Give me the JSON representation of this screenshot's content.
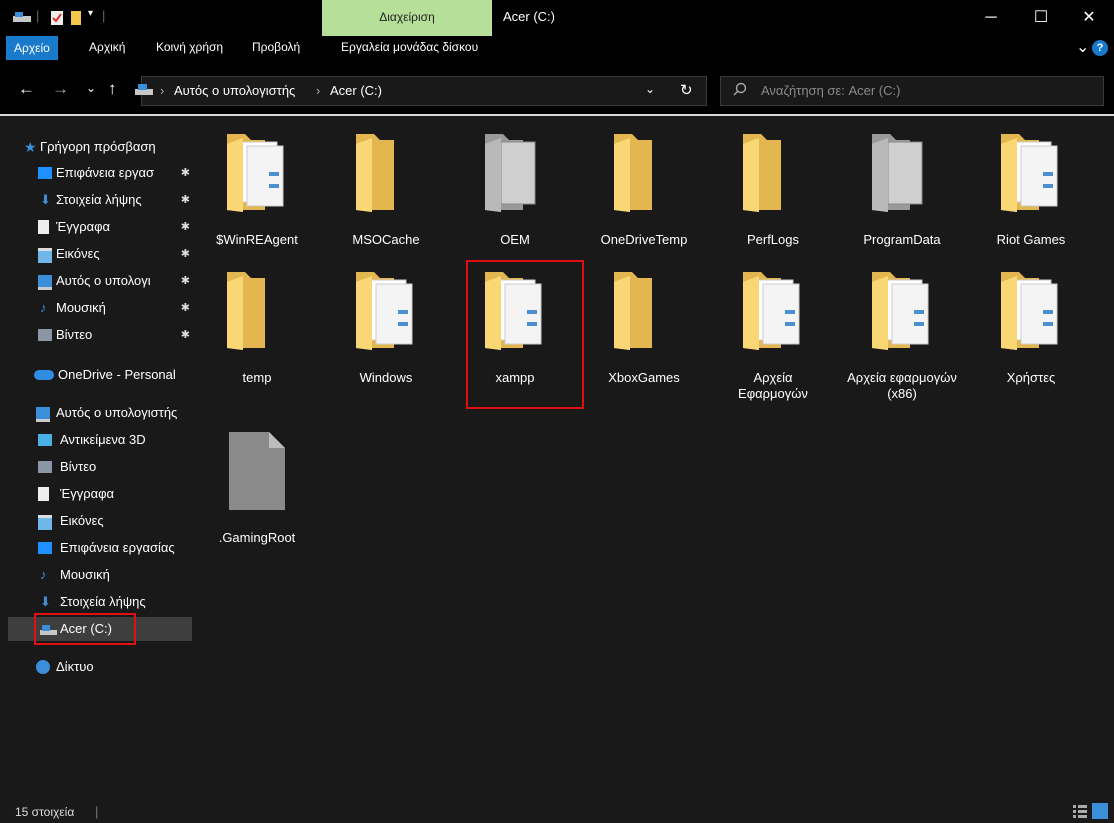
{
  "window": {
    "title": "Acer (C:)",
    "manage_tab": "Διαχείριση",
    "minimize": "─",
    "maximize": "☐",
    "close": "✕"
  },
  "ribbon": {
    "tabs": [
      "Αρχείο",
      "Αρχική",
      "Κοινή χρήση",
      "Προβολή",
      "Εργαλεία μονάδας δίσκου"
    ],
    "expand": "⌄",
    "help": "?"
  },
  "nav": {
    "back": "←",
    "forward": "→",
    "recent": "⌄",
    "up": "↑",
    "breadcrumb": [
      "Αυτός ο υπολογιστής",
      "Acer (C:)"
    ],
    "separator": "›",
    "dropdown": "⌄",
    "refresh": "↻",
    "search_placeholder": "Αναζήτηση σε: Acer (C:)"
  },
  "sidebar": {
    "quick_access": "Γρήγορη πρόσβαση",
    "quick_items": [
      "Επιφάνεια εργασ",
      "Στοιχεία λήψης",
      "Έγγραφα",
      "Εικόνες",
      "Αυτός ο υπολογι",
      "Μουσική",
      "Βίντεο"
    ],
    "pin": "📌",
    "onedrive": "OneDrive - Personal",
    "this_pc": "Αυτός ο υπολογιστής",
    "pc_items": [
      "Αντικείμενα 3D",
      "Βίντεο",
      "Έγγραφα",
      "Εικόνες",
      "Επιφάνεια εργασίας",
      "Μουσική",
      "Στοιχεία λήψης",
      "Acer (C:)"
    ],
    "network": "Δίκτυο"
  },
  "files": [
    {
      "name": "$WinREAgent",
      "kind": "folder-docs"
    },
    {
      "name": "MSOCache",
      "kind": "folder"
    },
    {
      "name": "OEM",
      "kind": "folder-gray"
    },
    {
      "name": "OneDriveTemp",
      "kind": "folder"
    },
    {
      "name": "PerfLogs",
      "kind": "folder"
    },
    {
      "name": "ProgramData",
      "kind": "folder-gray"
    },
    {
      "name": "Riot Games",
      "kind": "folder-docs"
    },
    {
      "name": "temp",
      "kind": "folder-plain"
    },
    {
      "name": "Windows",
      "kind": "folder-docs"
    },
    {
      "name": "xampp",
      "kind": "folder-docs"
    },
    {
      "name": "XboxGames",
      "kind": "folder-plain"
    },
    {
      "name": "Αρχεία Εφαρμογών",
      "kind": "folder-docs"
    },
    {
      "name": "Αρχεία εφαρμογών (x86)",
      "kind": "folder-docs"
    },
    {
      "name": "Χρήστες",
      "kind": "folder-docs"
    },
    {
      "name": ".GamingRoot",
      "kind": "file-gray"
    }
  ],
  "status": {
    "count": "15 στοιχεία"
  },
  "colors": {
    "accent": "#1979ca",
    "manage_tab": "#b6df9a",
    "highlight": "#e01010",
    "folder": "#f8d775",
    "folder_dark": "#e0a93a"
  }
}
